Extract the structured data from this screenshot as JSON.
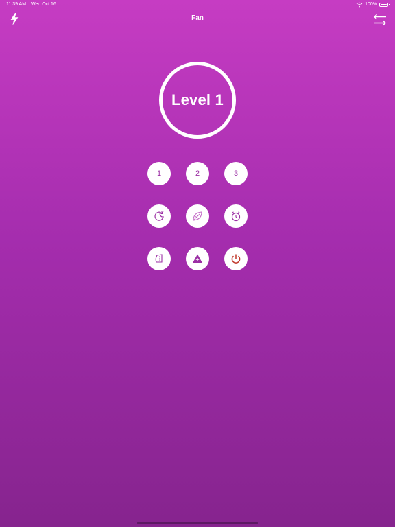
{
  "status_bar": {
    "time": "11:39 AM",
    "date": "Wed Oct 16",
    "battery": "100%"
  },
  "nav": {
    "title": "Fan",
    "left_icon": "flash-icon",
    "right_icon": "swap-arrows-icon"
  },
  "level": {
    "label": "Level 1"
  },
  "controls": {
    "speed_1": "1",
    "speed_2": "2",
    "speed_3": "3",
    "icons": [
      "sleep-moon-icon",
      "leaf-eco-icon",
      "alarm-timer-icon",
      "swing-icon",
      "temperature-up-icon",
      "power-icon"
    ]
  },
  "colors": {
    "gradient_top": "#C63CC3",
    "gradient_bottom": "#86248E",
    "accent": "#9B2FA4",
    "power": "#C0392B"
  }
}
